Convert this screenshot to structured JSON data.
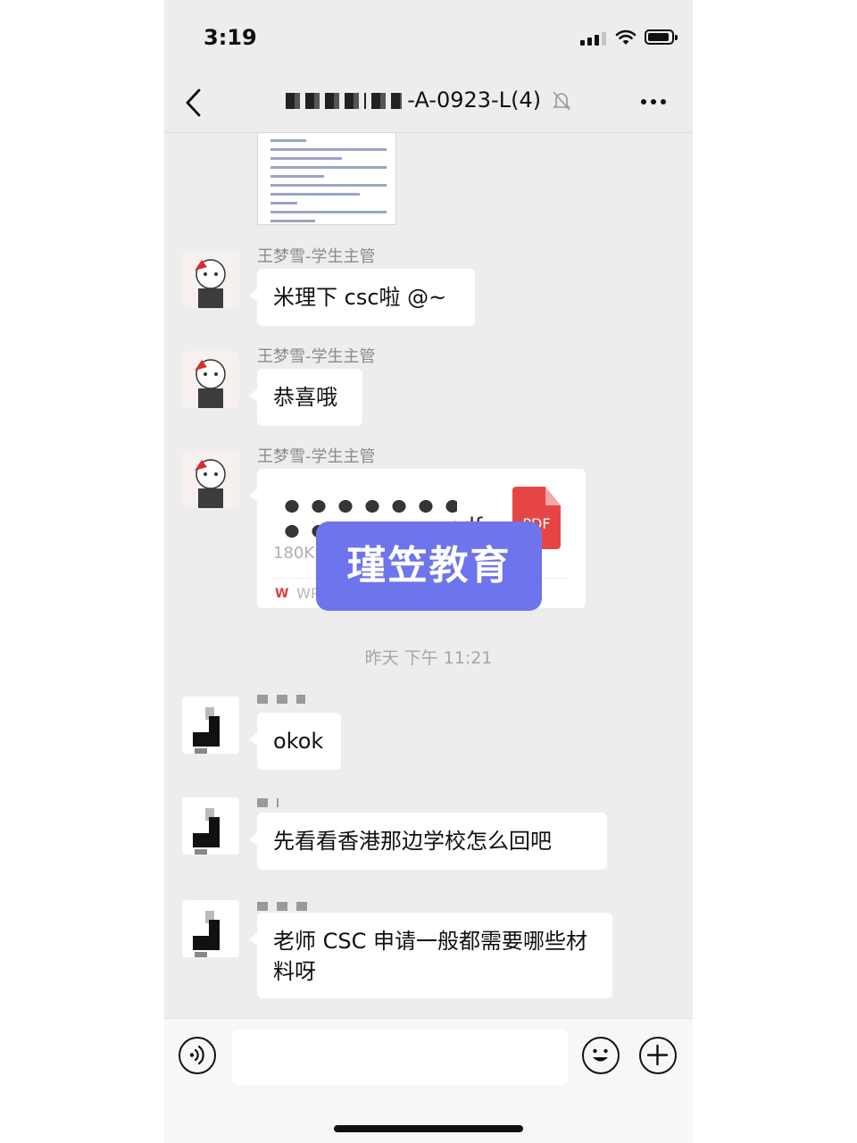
{
  "status_bar": {
    "time": "3:19"
  },
  "header": {
    "title_visible": "-A-0923-L(4)",
    "back_icon": "chevron-left-icon",
    "mute_icon": "bell-off-icon",
    "more_icon": "more-icon"
  },
  "messages": [
    {
      "sender": "王梦雪-学生主管",
      "text": "米理下 csc啦 @~"
    },
    {
      "sender": "王梦雪-学生主管",
      "text": "恭喜哦"
    },
    {
      "sender": "王梦雪-学生主管",
      "type": "file",
      "file_ext": "odf",
      "file_size": "180K",
      "file_source": "WPS Office",
      "file_icon_label": "PDF"
    }
  ],
  "watermark": "瑾笠教育",
  "timestamp": "昨天 下午 11:21",
  "replies": [
    {
      "text": "okok"
    },
    {
      "text": "先看看香港那边学校怎么回吧"
    },
    {
      "text": "老师 CSC 申请一般都需要哪些材料呀"
    }
  ],
  "input_bar": {
    "input_value": "",
    "voice_icon": "voice-icon",
    "emoji_icon": "emoji-icon",
    "plus_icon": "plus-icon"
  }
}
